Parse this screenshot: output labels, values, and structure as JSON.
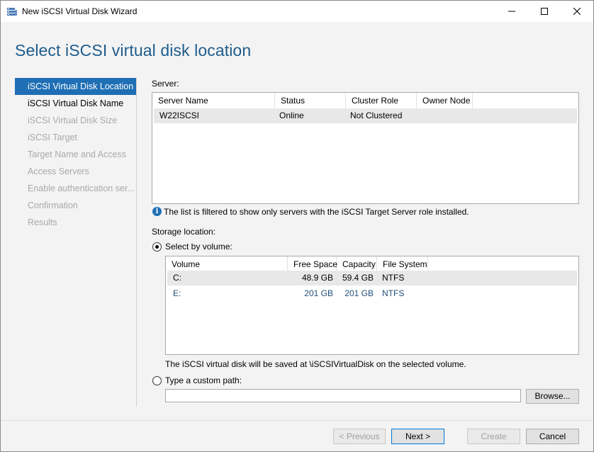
{
  "window": {
    "title": "New iSCSI Virtual Disk Wizard",
    "controls": {
      "minimize": "—",
      "maximize": "☐",
      "close": "✕"
    }
  },
  "page_title": "Select iSCSI virtual disk location",
  "nav": {
    "items": [
      {
        "label": "iSCSI Virtual Disk Location",
        "state": "active"
      },
      {
        "label": "iSCSI Virtual Disk Name",
        "state": "enabled"
      },
      {
        "label": "iSCSI Virtual Disk Size",
        "state": "disabled"
      },
      {
        "label": "iSCSI Target",
        "state": "disabled"
      },
      {
        "label": "Target Name and Access",
        "state": "disabled"
      },
      {
        "label": "Access Servers",
        "state": "disabled"
      },
      {
        "label": "Enable authentication ser...",
        "state": "disabled"
      },
      {
        "label": "Confirmation",
        "state": "disabled"
      },
      {
        "label": "Results",
        "state": "disabled"
      }
    ]
  },
  "server": {
    "label": "Server:",
    "columns": [
      "Server Name",
      "Status",
      "Cluster Role",
      "Owner Node"
    ],
    "rows": [
      {
        "server_name": "W22ISCSI",
        "status": "Online",
        "cluster_role": "Not Clustered",
        "owner_node": ""
      }
    ],
    "info_text": "The list is filtered to show only servers with the iSCSI Target Server role installed."
  },
  "storage": {
    "label": "Storage location:",
    "by_volume_label": "Select by volume:",
    "columns": [
      "Volume",
      "Free Space",
      "Capacity",
      "File System"
    ],
    "rows": [
      {
        "volume": "C:",
        "free_space": "48.9 GB",
        "capacity": "59.4 GB",
        "file_system": "NTFS"
      },
      {
        "volume": "E:",
        "free_space": "201 GB",
        "capacity": "201 GB",
        "file_system": "NTFS"
      }
    ],
    "save_note": "The iSCSI virtual disk will be saved at \\iSCSIVirtualDisk on the selected volume.",
    "custom_path_label": "Type a custom path:",
    "custom_path_value": "",
    "browse_label": "Browse..."
  },
  "footer": {
    "previous": "< Previous",
    "next": "Next >",
    "create": "Create",
    "cancel": "Cancel"
  },
  "colors": {
    "accent": "#1f6fb5",
    "title_blue": "#1e5c8c",
    "link_blue": "#1f4e79"
  }
}
